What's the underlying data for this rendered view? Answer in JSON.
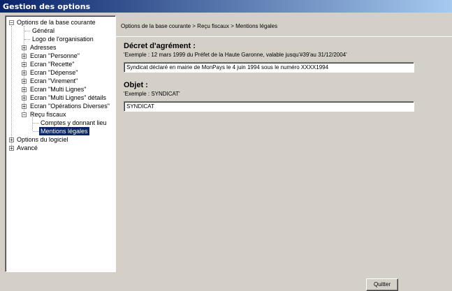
{
  "window": {
    "title": "Gestion des options"
  },
  "tree": {
    "items": [
      {
        "label": "Options de la base courante",
        "expander": "−"
      },
      {
        "label": "Général"
      },
      {
        "label": "Logo de l'organisation"
      },
      {
        "label": "Adresses",
        "expander": "+"
      },
      {
        "label": "Ecran \"Personne\"",
        "expander": "+"
      },
      {
        "label": "Ecran \"Recette\"",
        "expander": "+"
      },
      {
        "label": "Ecran \"Dépense\"",
        "expander": "+"
      },
      {
        "label": "Ecran \"Virement\"",
        "expander": "+"
      },
      {
        "label": "Ecran \"Multi Lignes\"",
        "expander": "+"
      },
      {
        "label": "Ecran \"Multi Lignes\" détails",
        "expander": "+"
      },
      {
        "label": "Ecran \"Opérations Diverses\"",
        "expander": "+"
      },
      {
        "label": "Reçu fiscaux",
        "expander": "−"
      },
      {
        "label": "Comptes y donnant lieu"
      },
      {
        "label": "Mentions légales",
        "selected": true
      },
      {
        "label": "Options du logiciel",
        "expander": "+"
      },
      {
        "label": "Avancé",
        "expander": "+"
      }
    ]
  },
  "content": {
    "breadcrumb": "Options de la base courante > Reçu fiscaux > Mentions légales",
    "decret": {
      "title": "Décret d'agrément :",
      "example": "'Exemple : 12 mars 1999 du Préfet de la Haute Garonne, valable jusqu'#39'au 31/12/2004'",
      "value": "Syndicat déclaré en mairie de MonPays le 4 juin 1994 sous le numéro XXXX1994"
    },
    "objet": {
      "title": "Objet :",
      "example": "'Exemple : SYNDICAT'",
      "value": "SYNDICAT"
    }
  },
  "footer": {
    "quit_label": "Quitter"
  }
}
